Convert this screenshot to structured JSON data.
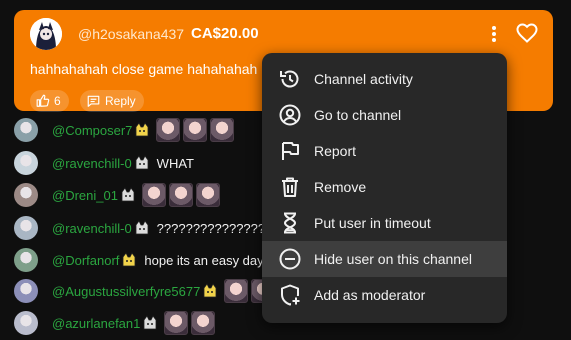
{
  "superchat": {
    "author": "@h2osakana437",
    "amount": "CA$20.00",
    "message": "hahhahahah close game hahahahah",
    "like_count": "6",
    "reply_label": "Reply",
    "colors": {
      "background": "#f57c00"
    }
  },
  "chat": [
    {
      "name": "@Composer7",
      "message": "",
      "emotes": 3,
      "badge": "cat-badge-gold"
    },
    {
      "name": "@ravenchill-0",
      "message": "WHAT",
      "emotes": 0,
      "badge": "cat-badge-gray"
    },
    {
      "name": "@Dreni_01",
      "message": "",
      "emotes": 3,
      "badge": "cat-badge-gray"
    },
    {
      "name": "@ravenchill-0",
      "message": "?????????????????????",
      "emotes": 0,
      "badge": "cat-badge-gray"
    },
    {
      "name": "@Dorfanorf",
      "message": "hope its an easy day",
      "emotes": 0,
      "badge": "cat-badge-gold"
    },
    {
      "name": "@Augustussilverfyre5677",
      "message": "",
      "emotes": 2,
      "badge": "cat-badge-gold"
    },
    {
      "name": "@azurlanefan1",
      "message": "",
      "emotes": 2,
      "badge": "cat-badge-gray"
    }
  ],
  "menu": {
    "items": [
      {
        "label": "Channel activity",
        "icon": "history-icon"
      },
      {
        "label": "Go to channel",
        "icon": "account-icon"
      },
      {
        "label": "Report",
        "icon": "flag-icon"
      },
      {
        "label": "Remove",
        "icon": "trash-icon"
      },
      {
        "label": "Put user in timeout",
        "icon": "hourglass-icon"
      },
      {
        "label": "Hide user on this channel",
        "icon": "hide-icon"
      },
      {
        "label": "Add as moderator",
        "icon": "add-moderator-icon"
      }
    ],
    "hovered_index": 5
  }
}
